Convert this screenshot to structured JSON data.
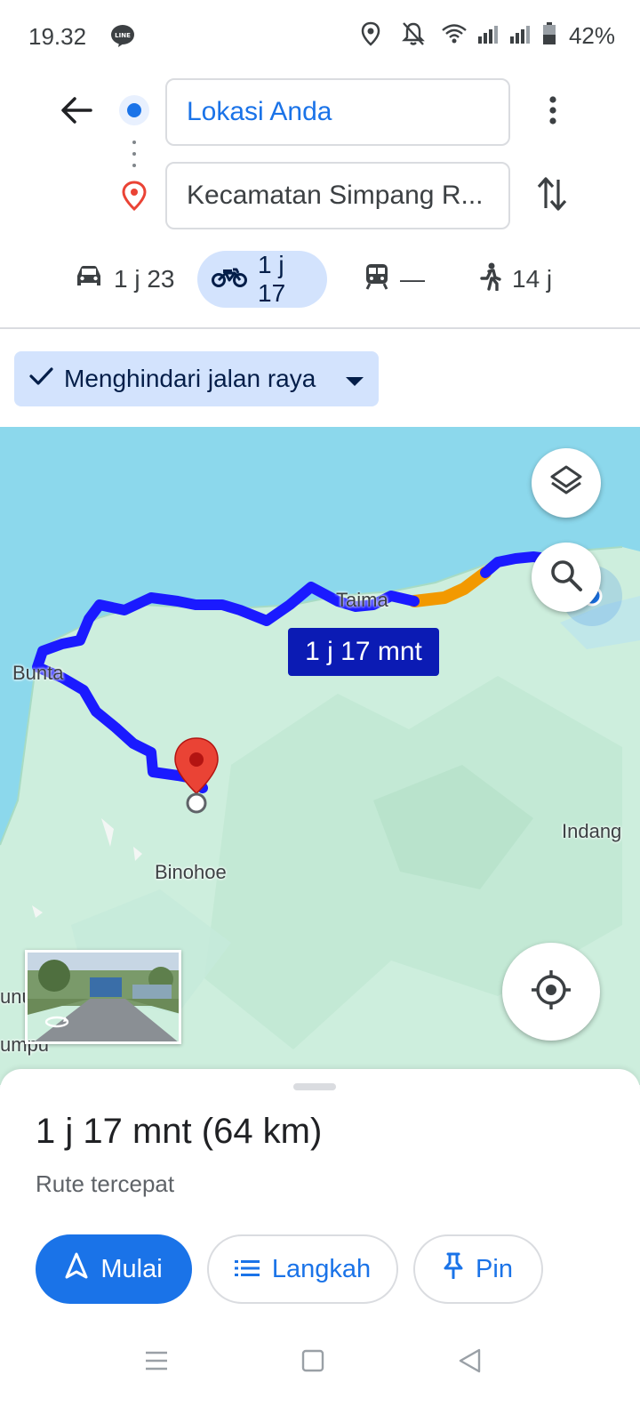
{
  "status_bar": {
    "time": "19.32",
    "battery": "42%",
    "icons": [
      "line-app-icon",
      "location-icon",
      "notifications-off-icon",
      "wifi-icon",
      "signal-icon",
      "signal-icon",
      "battery-icon"
    ]
  },
  "directions": {
    "origin": "Lokasi Anda",
    "destination": "Kecamatan Simpang R..."
  },
  "modes": [
    {
      "icon": "car-icon",
      "label": "1 j 23",
      "selected": false
    },
    {
      "icon": "motorcycle-icon",
      "label": "1 j 17",
      "selected": true
    },
    {
      "icon": "transit-icon",
      "label": "—",
      "selected": false
    },
    {
      "icon": "walk-icon",
      "label": "14 j",
      "selected": false
    }
  ],
  "chip": {
    "label": "Menghindari jalan raya",
    "icons": [
      "check-icon",
      "dropdown-icon"
    ]
  },
  "map": {
    "labels": {
      "bunta": "Bunta",
      "taima": "Taima",
      "binohoe": "Binohoe",
      "indang": "Indang",
      "edge1": "unu",
      "edge2": "umpu"
    },
    "eta": "1 j 17 mnt",
    "colors": {
      "water": "#8cd8ec",
      "land": "#cdeedd",
      "route": "#1a1aff",
      "traffic": "#f29900",
      "pin": "#ea4335"
    }
  },
  "sheet": {
    "summary": "1 j 17 mnt (64 km)",
    "subtitle": "Rute tercepat",
    "start_label": "Mulai",
    "steps_label": "Langkah",
    "pin_label": "Pin"
  },
  "colors": {
    "accent": "#1a73e8",
    "chip_bg": "#d3e3fd"
  }
}
